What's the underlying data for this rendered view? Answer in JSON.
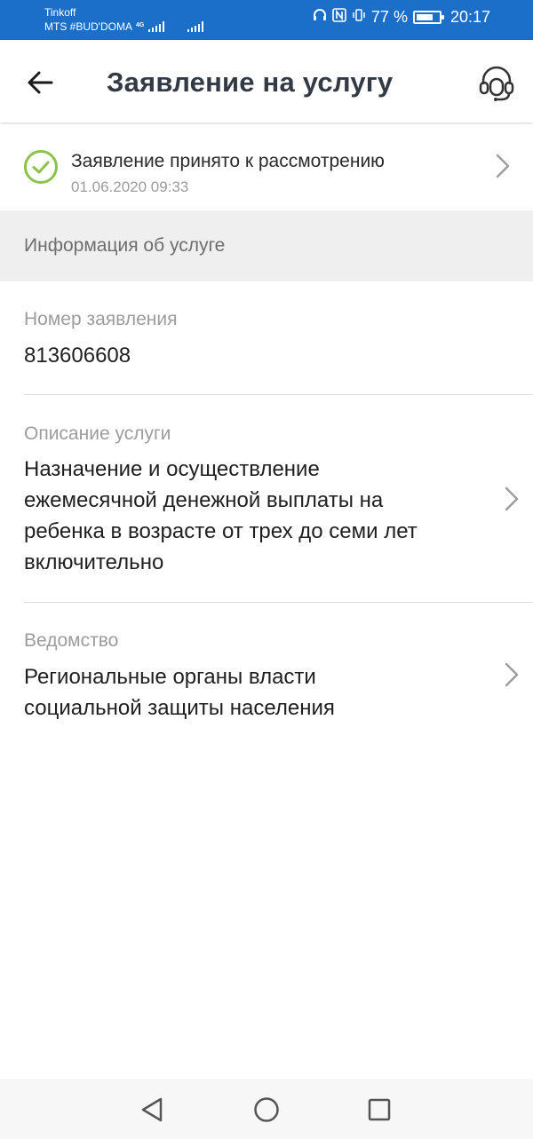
{
  "status_bar": {
    "carrier1": "Tinkoff",
    "carrier2": "MTS #BUD'DOMA",
    "network": "4G",
    "battery": "77 %",
    "battery_level": 0.77,
    "time": "20:17"
  },
  "header": {
    "title": "Заявление на услугу"
  },
  "application_status": {
    "text": "Заявление принято к рассмотрению",
    "date": "01.06.2020 09:33",
    "color": "#8bc34a"
  },
  "section": {
    "title": "Информация об услуге"
  },
  "fields": [
    {
      "label": "Номер заявления",
      "value": "813606608"
    },
    {
      "label": "Описание услуги",
      "value_lines": [
        "Назначение и осуществление",
        "ежемесячной денежной выплаты на",
        "ребенка в возрасте от трех до семи лет",
        "включительно"
      ]
    },
    {
      "label": "Ведомство",
      "value_lines": [
        "Региональные органы власти",
        "социальной защиты населения"
      ]
    }
  ],
  "icons": {
    "back": "arrow-left-icon",
    "support": "headset-icon",
    "status": "check-circle-icon",
    "chevron": "chevron-right-icon"
  },
  "colors": {
    "status_bar": "#1b6fc8",
    "title": "#333a45",
    "section_bg": "#efefef"
  }
}
